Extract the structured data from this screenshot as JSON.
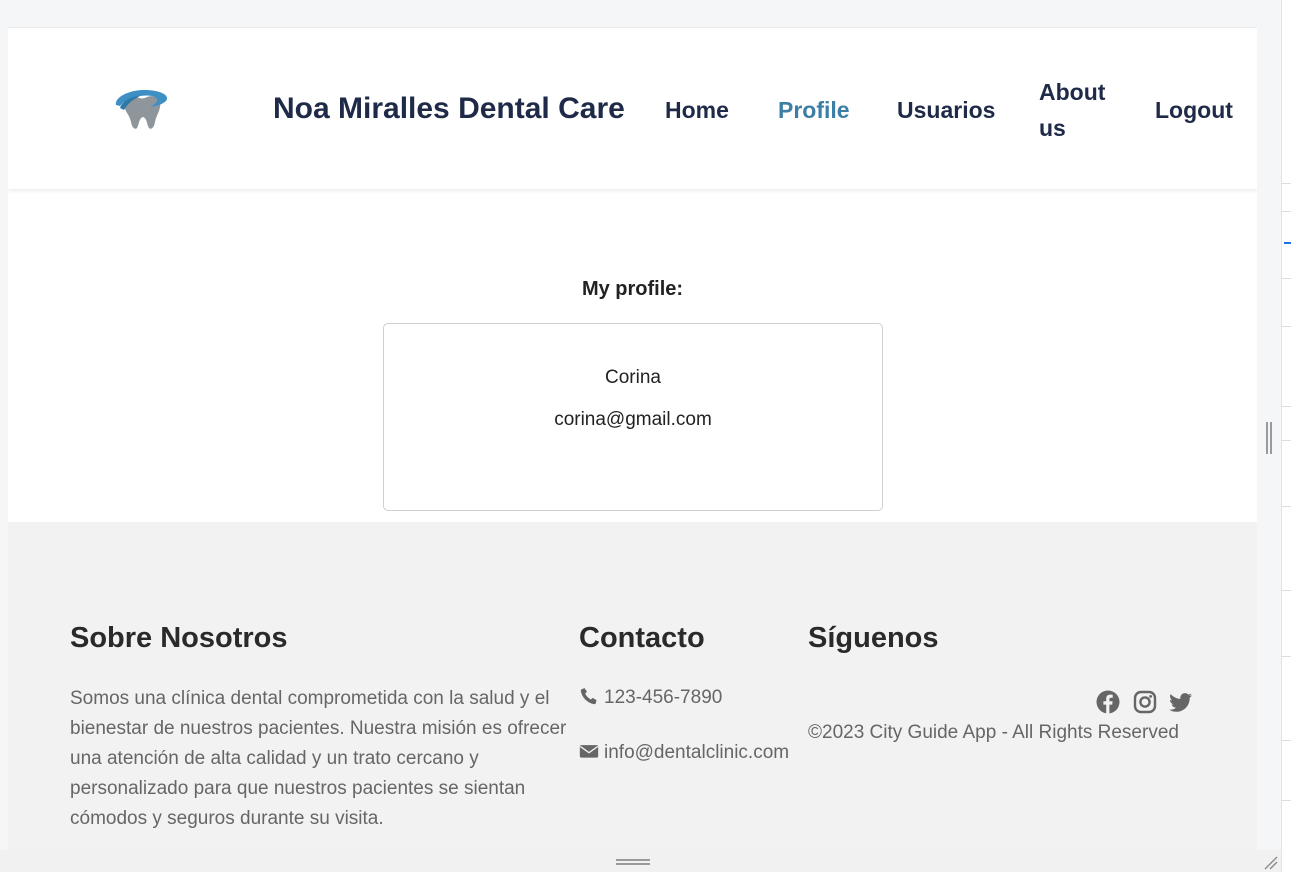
{
  "header": {
    "brand": "Noa Miralles Dental Care",
    "logo_icon": "tooth-logo-icon",
    "nav": [
      {
        "label": "Home",
        "active": false
      },
      {
        "label": "Profile",
        "active": true
      },
      {
        "label": "Usuarios",
        "active": false
      },
      {
        "label": "About us",
        "active": false
      },
      {
        "label": "Logout",
        "active": false
      }
    ]
  },
  "profile": {
    "heading": "My profile:",
    "name": "Corina",
    "email": "corina@gmail.com"
  },
  "footer": {
    "about": {
      "title": "Sobre Nosotros",
      "text": "Somos una clínica dental comprometida con la salud y el bienestar de nuestros pacientes. Nuestra misión es ofrecer una atención de alta calidad y un trato cercano y personalizado para que nuestros pacientes se sientan cómodos y seguros durante su visita."
    },
    "contact": {
      "title": "Contacto",
      "phone": "123-456-7890",
      "email": "info@dentalclinic.com",
      "phone_icon": "phone-icon",
      "email_icon": "envelope-icon"
    },
    "follow": {
      "title": "Síguenos",
      "socials": [
        "facebook-icon",
        "instagram-icon",
        "twitter-icon"
      ],
      "copyright": "©2023 City Guide App - All Rights Reserved"
    }
  },
  "colors": {
    "brand_text": "#1e2a47",
    "active_link": "#3d7ea6",
    "footer_bg": "#f2f2f2",
    "muted_text": "#666666"
  }
}
